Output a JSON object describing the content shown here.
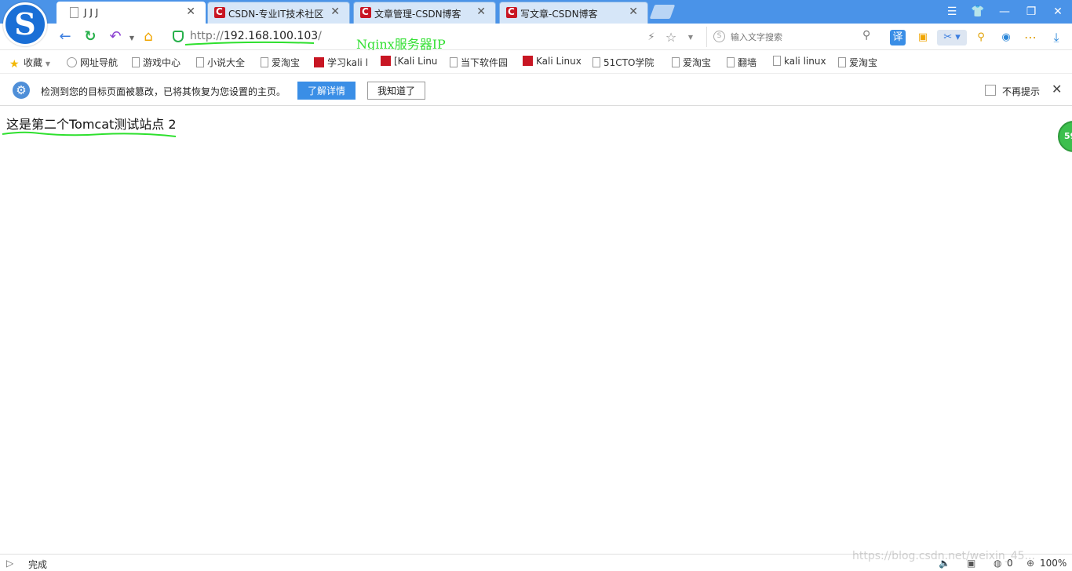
{
  "tabs": [
    {
      "label": "J J J",
      "icon": "page-icon",
      "active": true
    },
    {
      "label": "CSDN-专业IT技术社区",
      "icon": "csdn-icon",
      "active": false
    },
    {
      "label": "文章管理-CSDN博客",
      "icon": "csdn-icon",
      "active": false
    },
    {
      "label": "写文章-CSDN博客",
      "icon": "csdn-icon",
      "active": false
    }
  ],
  "tab_close_glyph": "✕",
  "window_controls": {
    "menu": "☰",
    "skin": "👕",
    "minimize": "—",
    "restore": "❐",
    "close": "✕"
  },
  "address": {
    "scheme": "http://",
    "host": "192.168.100.103",
    "path": "/"
  },
  "annotation": "Nginx服务器IP",
  "search": {
    "placeholder": "输入文字搜索"
  },
  "bookmarks": [
    {
      "label": "收藏",
      "icon": "star-icon"
    },
    {
      "label": "网址导航",
      "icon": "globe-icon"
    },
    {
      "label": "游戏中心",
      "icon": "page-icon"
    },
    {
      "label": "小说大全",
      "icon": "page-icon"
    },
    {
      "label": "爱淘宝",
      "icon": "page-icon"
    },
    {
      "label": "学习kali l",
      "icon": "csdn-icon"
    },
    {
      "label": "[Kali Linu",
      "icon": "csdn-icon"
    },
    {
      "label": "当下软件园",
      "icon": "page-icon"
    },
    {
      "label": "Kali Linux",
      "icon": "csdn-icon"
    },
    {
      "label": "51CTO学院",
      "icon": "page-icon"
    },
    {
      "label": "爱淘宝",
      "icon": "page-icon"
    },
    {
      "label": "翻墙",
      "icon": "page-icon"
    },
    {
      "label": "kali linux",
      "icon": "page-icon"
    },
    {
      "label": "爱淘宝",
      "icon": "page-icon"
    }
  ],
  "notice": {
    "text": "检测到您的目标页面被篡改，已将其恢复为您设置的主页。",
    "details_button": "了解详情",
    "ok_button": "我知道了",
    "no_remind_label": "不再提示"
  },
  "page": {
    "body_text": "这是第二个Tomcat测试站点 2"
  },
  "float_badge": "59",
  "status": {
    "state": "完成",
    "block_count": "0",
    "zoom": "100%"
  },
  "watermark": "https://blog.csdn.net/weixin_45..."
}
